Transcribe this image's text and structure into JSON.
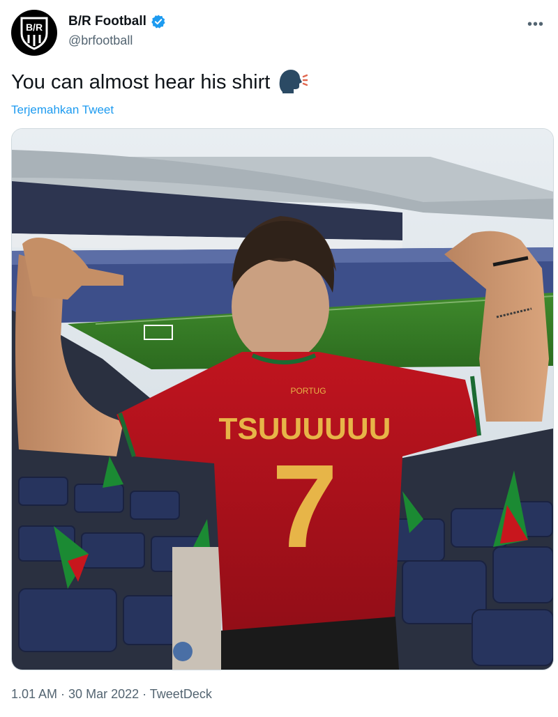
{
  "account": {
    "display_name": "B/R Football",
    "handle": "@brfootball",
    "logo_text": "B/R",
    "verified": true
  },
  "menu": {
    "more_label": "•••"
  },
  "tweet": {
    "text": "You can almost hear his shirt",
    "emoji_icon": "speaking-head-icon",
    "translate_label": "Terjemahkan Tweet"
  },
  "media": {
    "shirt_chest_text": "PORTUG",
    "shirt_name": "TSUUUUUU",
    "shirt_number": "7"
  },
  "footer": {
    "time": "1.01 AM",
    "separator": " · ",
    "date": "30 Mar 2022",
    "source": "TweetDeck"
  },
  "colors": {
    "accent": "#1d9bf0",
    "text": "#0f1419",
    "muted": "#536471",
    "shirt_red": "#b0111c",
    "shirt_gold": "#e7b548"
  }
}
